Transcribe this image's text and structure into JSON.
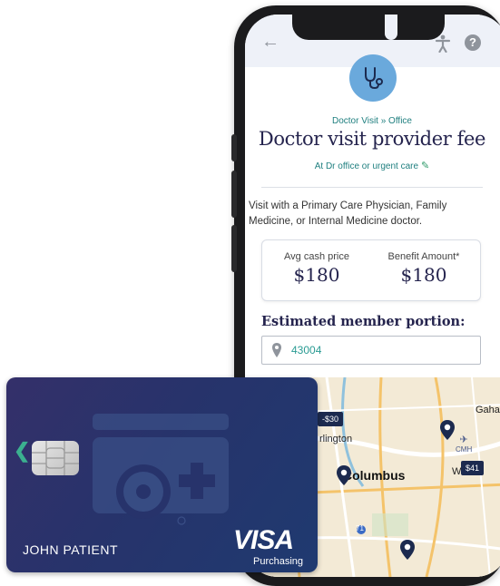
{
  "header": {
    "back_icon": "back-arrow-icon",
    "accessibility_icon": "accessibility-icon",
    "help_glyph": "?"
  },
  "service": {
    "icon": "stethoscope-icon",
    "breadcrumb": "Doctor Visit » Office",
    "title": "Doctor visit provider fee",
    "location_label": "At Dr office or urgent care",
    "description": "Visit with a Primary Care Physician, Family Medicine, or Internal Medicine doctor."
  },
  "prices": {
    "avg_cash_label": "Avg cash price",
    "avg_cash_value": "$180",
    "benefit_label": "Benefit Amount*",
    "benefit_value": "$180"
  },
  "estimate": {
    "heading": "Estimated member portion:",
    "zip_value": "43004"
  },
  "map": {
    "price_tag_1": "-$30",
    "price_tag_2": "$41",
    "city_columbus": "Columbus",
    "city_arlington": "rlington",
    "city_gahanna": "Gahanna",
    "city_w": "W",
    "airport_code": "CMH",
    "route_number": "71"
  },
  "card": {
    "holder_name": "JOHN PATIENT",
    "brand": "VISA",
    "brand_sub": "Purchasing"
  },
  "colors": {
    "accent_teal": "#1f7f7f",
    "title_navy": "#25244e",
    "icon_blue": "#6aa9dc",
    "card_navy": "#27336b"
  }
}
